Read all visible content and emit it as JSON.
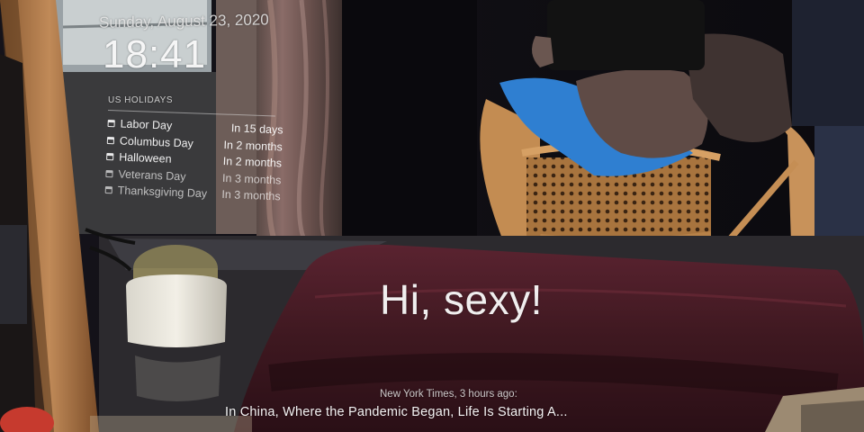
{
  "clock": {
    "date": "Sunday, August 23, 2020",
    "time": "18:41"
  },
  "holidays": {
    "header": "US HOLIDAYS",
    "items": [
      {
        "name": "Labor Day",
        "when": "In 15 days"
      },
      {
        "name": "Columbus Day",
        "when": "In 2 months"
      },
      {
        "name": "Halloween",
        "when": "In 2 months"
      },
      {
        "name": "Veterans Day",
        "when": "In 3 months"
      },
      {
        "name": "Thanksgiving Day",
        "when": "In 3 months"
      }
    ]
  },
  "compliment": {
    "text": "Hi, sexy!"
  },
  "news": {
    "source": "New York Times, 3 hours ago:",
    "headline": "In China, Where the Pandemic Began, Life Is Starting A..."
  },
  "colors": {
    "wood_frame": "#b07a4a",
    "wall_dark": "#0e0c12",
    "pillow": "#4a1c24",
    "shirt": "#2f7fd1"
  }
}
